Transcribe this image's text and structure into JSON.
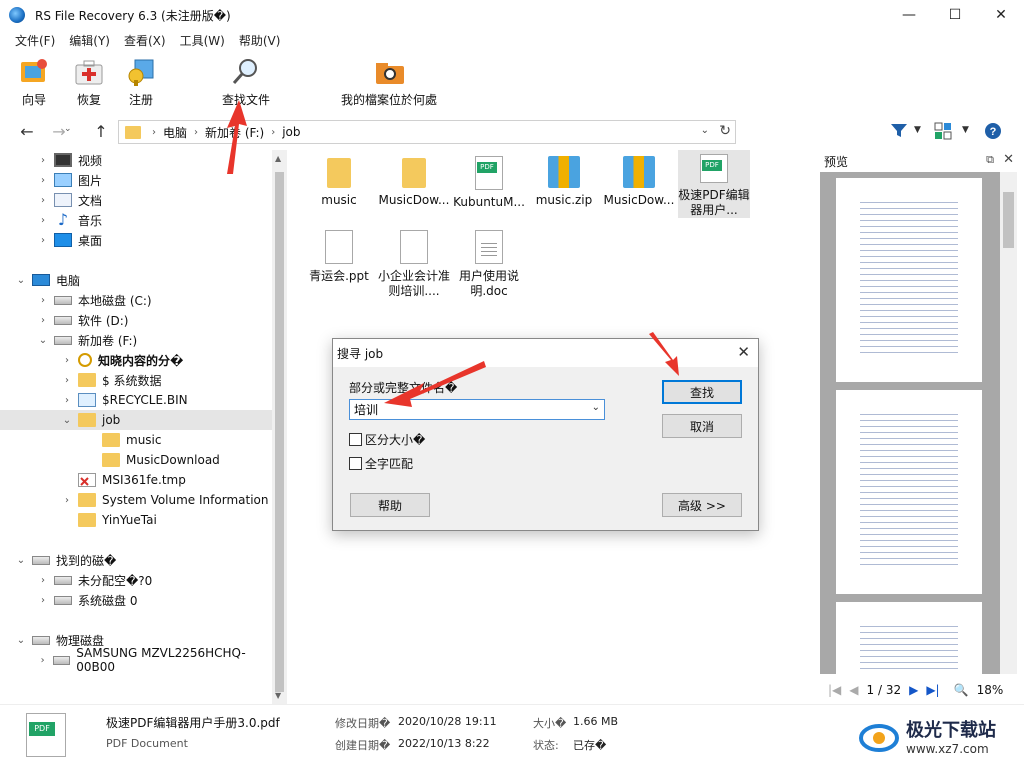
{
  "window": {
    "title": "RS File Recovery 6.3 (未注册版�)",
    "controls": {
      "minimize": "—",
      "maximize": "☐",
      "close": "✕"
    }
  },
  "menubar": [
    "文件(F)",
    "编辑(Y)",
    "查看(X)",
    "工具(W)",
    "帮助(V)"
  ],
  "toolbar": {
    "wizard": "向导",
    "restore": "恢复",
    "register": "注册",
    "find_files": "查找文件",
    "where_files": "我的檔案位於何處"
  },
  "address": {
    "crumbs": [
      "电脑",
      "新加卷 (F:)",
      "job"
    ],
    "separator": "›"
  },
  "tree": {
    "items": [
      {
        "label": "视频",
        "icon": "video-icon",
        "chev": "›"
      },
      {
        "label": "图片",
        "icon": "pictures-icon",
        "chev": "›"
      },
      {
        "label": "文档",
        "icon": "documents-icon",
        "chev": "›"
      },
      {
        "label": "音乐",
        "icon": "music-icon",
        "chev": "›"
      },
      {
        "label": "桌面",
        "icon": "desktop-icon",
        "chev": "›"
      },
      {
        "label": "电脑",
        "icon": "computer-icon",
        "chev": "⌄"
      },
      {
        "label": "本地磁盘 (C:)",
        "icon": "drive-icon",
        "chev": "›"
      },
      {
        "label": "软件 (D:)",
        "icon": "drive-icon",
        "chev": "›"
      },
      {
        "label": "新加卷 (F:)",
        "icon": "drive-icon",
        "chev": "⌄"
      },
      {
        "label": "知晓内容的分�",
        "icon": "search-folder-icon",
        "chev": "›"
      },
      {
        "label": "$ 系统数据",
        "icon": "folder-icon",
        "chev": "›"
      },
      {
        "label": "$RECYCLE.BIN",
        "icon": "recycle-bin-icon",
        "chev": "›"
      },
      {
        "label": "job",
        "icon": "folder-icon",
        "chev": "⌄"
      },
      {
        "label": "music",
        "icon": "folder-icon",
        "chev": ""
      },
      {
        "label": "MusicDownload",
        "icon": "folder-icon",
        "chev": ""
      },
      {
        "label": "MSI361fe.tmp",
        "icon": "deleted-file-icon",
        "chev": ""
      },
      {
        "label": "System Volume Information",
        "icon": "folder-icon",
        "chev": "›"
      },
      {
        "label": "YinYueTai",
        "icon": "folder-icon",
        "chev": ""
      },
      {
        "label": "找到的磁�",
        "icon": "drive-icon",
        "chev": "⌄"
      },
      {
        "label": "未分配空�?0",
        "icon": "drive-icon",
        "chev": "›"
      },
      {
        "label": "系统磁盘 0",
        "icon": "drive-icon",
        "chev": "›"
      },
      {
        "label": "物理磁盘",
        "icon": "drive-icon",
        "chev": "⌄"
      },
      {
        "label": "SAMSUNG MZVL2256HCHQ-00B00",
        "icon": "drive-icon",
        "chev": "›"
      }
    ]
  },
  "files": [
    {
      "name": "music",
      "type": "folder"
    },
    {
      "name": "MusicDow...",
      "type": "folder"
    },
    {
      "name": "KubuntuM...",
      "type": "pdf"
    },
    {
      "name": "music.zip",
      "type": "zip"
    },
    {
      "name": "MusicDow...",
      "type": "zip"
    },
    {
      "name": "极速PDF编辑器用户...",
      "type": "pdf"
    },
    {
      "name": "青运会.ppt",
      "type": "blank"
    },
    {
      "name": "小企业会计准则培训....",
      "type": "blank"
    },
    {
      "name": "用户使用说明.doc",
      "type": "doc"
    }
  ],
  "preview": {
    "title": "预览",
    "pin": "⧉",
    "close": "✕",
    "page_indicator": "1 / 32",
    "zoom": "18%",
    "nav": {
      "first": "|◀",
      "prev": "◀",
      "next": "▶",
      "last": "▶|",
      "zoom_icon": "🔍"
    }
  },
  "status": {
    "filename": "极速PDF编辑器用户手册3.0.pdf",
    "filetype": "PDF Document",
    "modified_label": "修改日期�",
    "modified_value": "2020/10/28 19:11",
    "created_label": "创建日期�",
    "created_value": "2022/10/13 8:22",
    "size_label": "大小�",
    "size_value": "1.66 MB",
    "state_label": "状态:",
    "state_value": "已存�"
  },
  "dialog": {
    "title": "搜寻 job",
    "close": "✕",
    "label": "部分或完整文件名�",
    "input_value": "培训",
    "case_sensitive": "区分大小�",
    "whole_word": "全字匹配",
    "find_button": "查找",
    "cancel_button": "取消",
    "help_button": "帮助",
    "advanced_button": "高级 >>"
  },
  "watermark": {
    "title": "极光下载站",
    "url": "www.xz7.com"
  },
  "colors": {
    "annotation_arrow": "#e8352b",
    "accent": "#0078d7",
    "folder": "#f4c95d",
    "pdf": "#21a366"
  }
}
